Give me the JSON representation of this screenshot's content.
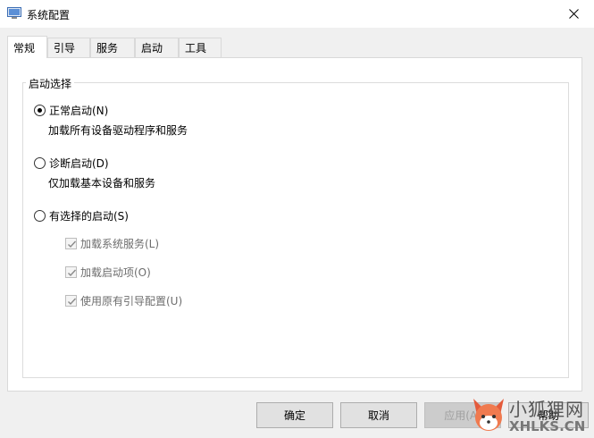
{
  "window": {
    "title": "系统配置",
    "icon": "msconfig-app-icon"
  },
  "tabs": [
    {
      "label": "常规",
      "active": true
    },
    {
      "label": "引导",
      "active": false
    },
    {
      "label": "服务",
      "active": false
    },
    {
      "label": "启动",
      "active": false
    },
    {
      "label": "工具",
      "active": false
    }
  ],
  "startup": {
    "group_label": "启动选择",
    "options": [
      {
        "label": "正常启动(N)",
        "description": "加载所有设备驱动程序和服务",
        "checked": true
      },
      {
        "label": "诊断启动(D)",
        "description": "仅加载基本设备和服务",
        "checked": false
      },
      {
        "label": "有选择的启动(S)",
        "checked": false
      }
    ],
    "selective_items": [
      {
        "label": "加载系统服务(L)",
        "checked": true,
        "disabled": true
      },
      {
        "label": "加载启动项(O)",
        "checked": true,
        "disabled": true
      },
      {
        "label": "使用原有引导配置(U)",
        "checked": true,
        "disabled": true
      }
    ]
  },
  "buttons": {
    "ok": "确定",
    "cancel": "取消",
    "apply": "应用(A)",
    "help": "帮助"
  },
  "watermark": {
    "cn": "小狐狸网",
    "en": "XHLKS.CN"
  }
}
